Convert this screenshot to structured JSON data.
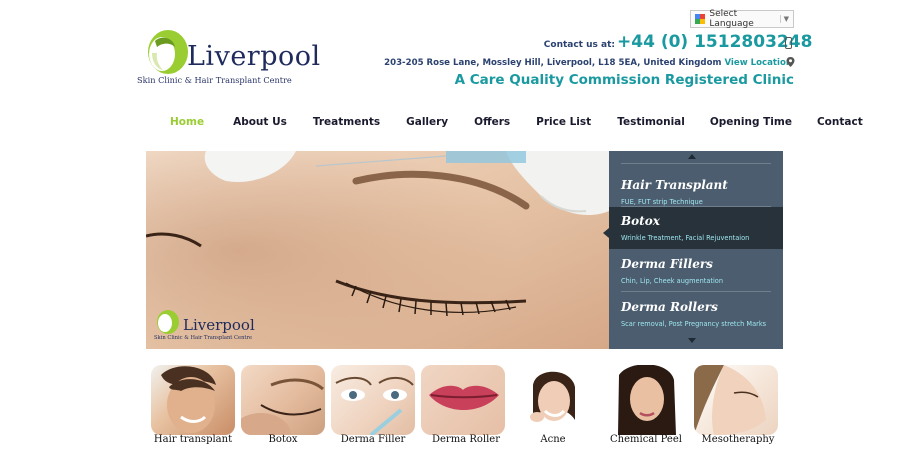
{
  "language_selector": {
    "label": "Select Language",
    "icon": "google-translate-icon"
  },
  "logo": {
    "name": "Liverpool",
    "tagline": "Skin Clinic & Hair Transplant Centre"
  },
  "contact": {
    "label": "Contact us at:",
    "phone": "+44 (0) 1512803248",
    "address": "203-205 Rose Lane, Mossley Hill, Liverpool, L18 5EA, United Kingdom",
    "location_link": "View Location",
    "tagline": "A Care Quality Commission Registered Clinic"
  },
  "nav": {
    "items": [
      "Home",
      "About Us",
      "Treatments",
      "Gallery",
      "Offers",
      "Price List",
      "Testimonial",
      "Opening Time",
      "Contact"
    ],
    "active": "Home"
  },
  "hero": {
    "logo_name": "Liverpool",
    "logo_tagline": "Skin Clinic & Hair Transplant Centre"
  },
  "slider_panel": {
    "items": [
      {
        "title": "Hair Transplant",
        "subtitle": "FUE, FUT strip Technique"
      },
      {
        "title": "Botox",
        "subtitle": "Wrinkle Treatment, Facial Rejuventaion"
      },
      {
        "title": "Derma Fillers",
        "subtitle": "Chin, Lip, Cheek augmentation"
      },
      {
        "title": "Derma Rollers",
        "subtitle": "Scar removal, Post Pregnancy stretch Marks"
      }
    ],
    "active": "Botox"
  },
  "treatments": [
    "Hair transplant",
    "Botox",
    "Derma Filler",
    "Derma Roller",
    "Acne",
    "Chemical Peel",
    "Mesotheraphy"
  ],
  "colors": {
    "teal": "#1a9aa0",
    "navy": "#1e2b5c",
    "green": "#9acd32",
    "panel": "#4b5d6e",
    "panel_active": "#27323b"
  }
}
